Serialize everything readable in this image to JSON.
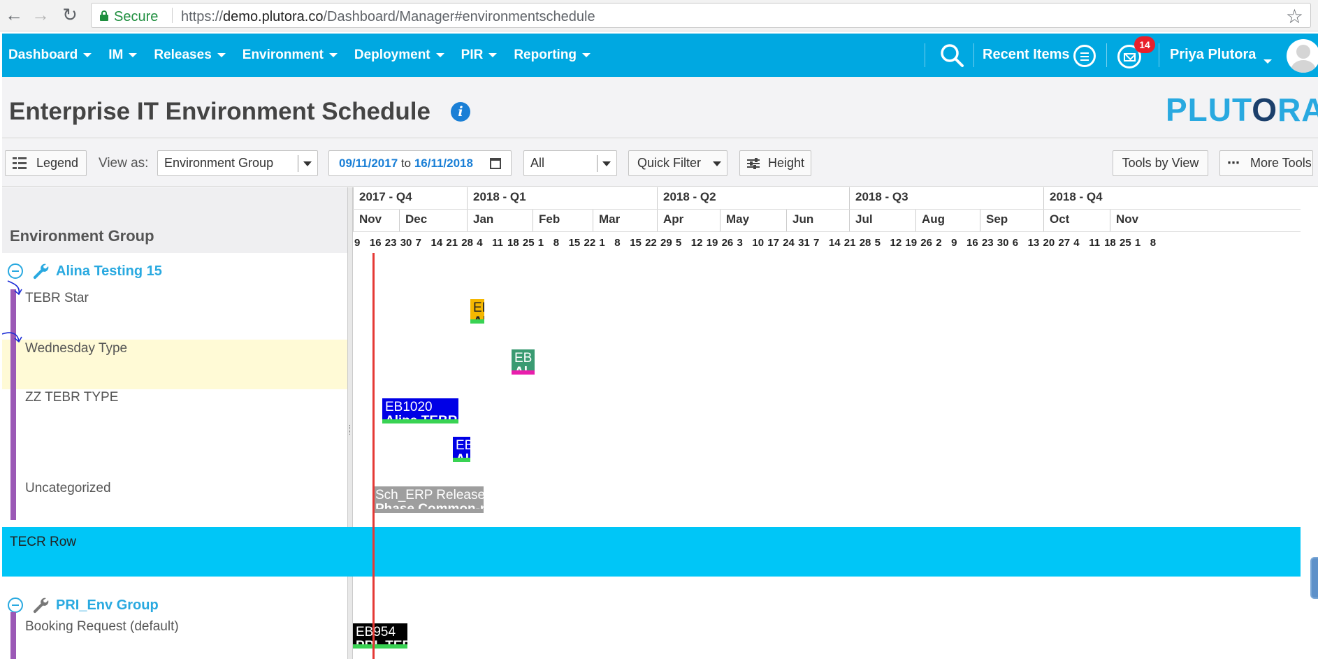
{
  "browser": {
    "secure_label": "Secure",
    "url_scheme": "https://",
    "url_host": "demo.plutora.co",
    "url_path": "/Dashboard/Manager#environmentschedule"
  },
  "nav": {
    "menu": [
      "Dashboard",
      "IM",
      "Releases",
      "Environment",
      "Deployment",
      "PIR",
      "Reporting"
    ],
    "recent_items": "Recent Items",
    "notification_count": "14",
    "user_name": "Priya Plutora"
  },
  "page": {
    "title": "Enterprise IT Environment Schedule",
    "logo": "PLUTORA"
  },
  "toolbar": {
    "legend_label": "Legend",
    "view_as_label": "View as:",
    "view_as_value": "Environment Group",
    "date_from": "09/11/2017",
    "date_to_word": "to",
    "date_to": "16/11/2018",
    "filter_value": "All",
    "quick_filter_label": "Quick Filter",
    "height_label": "Height",
    "tools_by_view_label": "Tools by View",
    "more_tools_label": "More Tools"
  },
  "left_panel": {
    "header": "Environment Group",
    "groups": [
      {
        "name": "Alina Testing 15",
        "rows": [
          "TEBR Star",
          "Wednesday Type",
          "ZZ TEBR TYPE",
          "Uncategorized"
        ]
      },
      {
        "name": "PRI_Env Group",
        "rows": [
          "Booking Request (default)"
        ]
      }
    ],
    "band_label": "TECR Row"
  },
  "timeline": {
    "quarters": [
      "2017 - Q4",
      "2018 - Q1",
      "2018 - Q2",
      "2018 - Q3",
      "2018 - Q4"
    ],
    "months": [
      "Nov",
      "Dec",
      "Jan",
      "Feb",
      "Mar",
      "Apr",
      "May",
      "Jun",
      "Jul",
      "Aug",
      "Sep",
      "Oct",
      "Nov"
    ],
    "weeks": [
      "9",
      "16",
      "23",
      "30",
      "7",
      "14",
      "21",
      "28",
      "4",
      "11",
      "18",
      "25",
      "1",
      "8",
      "15",
      "22",
      "1",
      "8",
      "15",
      "22",
      "29",
      "5",
      "12",
      "19",
      "26",
      "3",
      "10",
      "17",
      "24",
      "31",
      "7",
      "14",
      "21",
      "28",
      "5",
      "12",
      "19",
      "26",
      "2",
      "9",
      "16",
      "23",
      "30",
      "6",
      "13",
      "20",
      "27",
      "4",
      "11",
      "18",
      "25",
      "1",
      "8"
    ],
    "bars": [
      {
        "t1": "EB",
        "t2": "Al",
        "color": "#f5b700",
        "strip": "#39d353",
        "text": "#222"
      },
      {
        "t1": "EB",
        "t2": "Al",
        "color": "#3a9b72",
        "strip": "#e91eac",
        "text": "#fff"
      },
      {
        "t1": "EB1020",
        "t2": "Alina TEBR",
        "color": "#0000e6",
        "strip": "#39d353",
        "text": "#fff"
      },
      {
        "t1": "EB",
        "t2": "Al",
        "color": "#0000e6",
        "strip": "#39d353",
        "text": "#fff"
      },
      {
        "t1": "Sch_ERP Release",
        "t2": "Phase Common-n",
        "color": "#9e9e9e",
        "strip": "#9e9e9e",
        "text": "#fff"
      },
      {
        "t1": "EB954",
        "t2": "PRI_TEB",
        "color": "#000000",
        "strip": "#39d353",
        "text": "#fff"
      }
    ]
  }
}
